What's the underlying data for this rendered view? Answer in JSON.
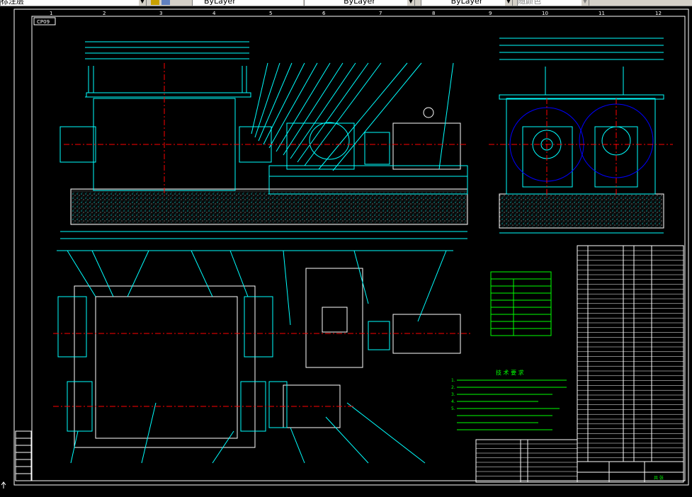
{
  "toolbar": {
    "layer_name": "标注层",
    "color_value": "ByLayer",
    "linetype_value": "ByLayer",
    "lineweight_value": "ByLayer",
    "plotstyle_value": "随颜色"
  },
  "drawing": {
    "title_block_code": "CP09",
    "grid_columns": [
      "1",
      "2",
      "3",
      "4",
      "5",
      "6",
      "7",
      "8",
      "9",
      "10",
      "11",
      "12"
    ],
    "tech_requirements_title": "技 术 要 求",
    "tech_requirements": [
      "1. ",
      "2. ",
      "3. ",
      "4. ",
      "5. "
    ],
    "title_block_name": "",
    "sheet_label": "共 张"
  },
  "colors": {
    "background": "#000000",
    "frame": "#ffffff",
    "outline": "#00ffff",
    "centerline": "#ff0000",
    "motor": "#ffffff",
    "dimension": "#00ffff",
    "text_green": "#00ff00",
    "blue_arc": "#0000ff",
    "yellow": "#ffff00",
    "magenta": "#ff00ff"
  }
}
